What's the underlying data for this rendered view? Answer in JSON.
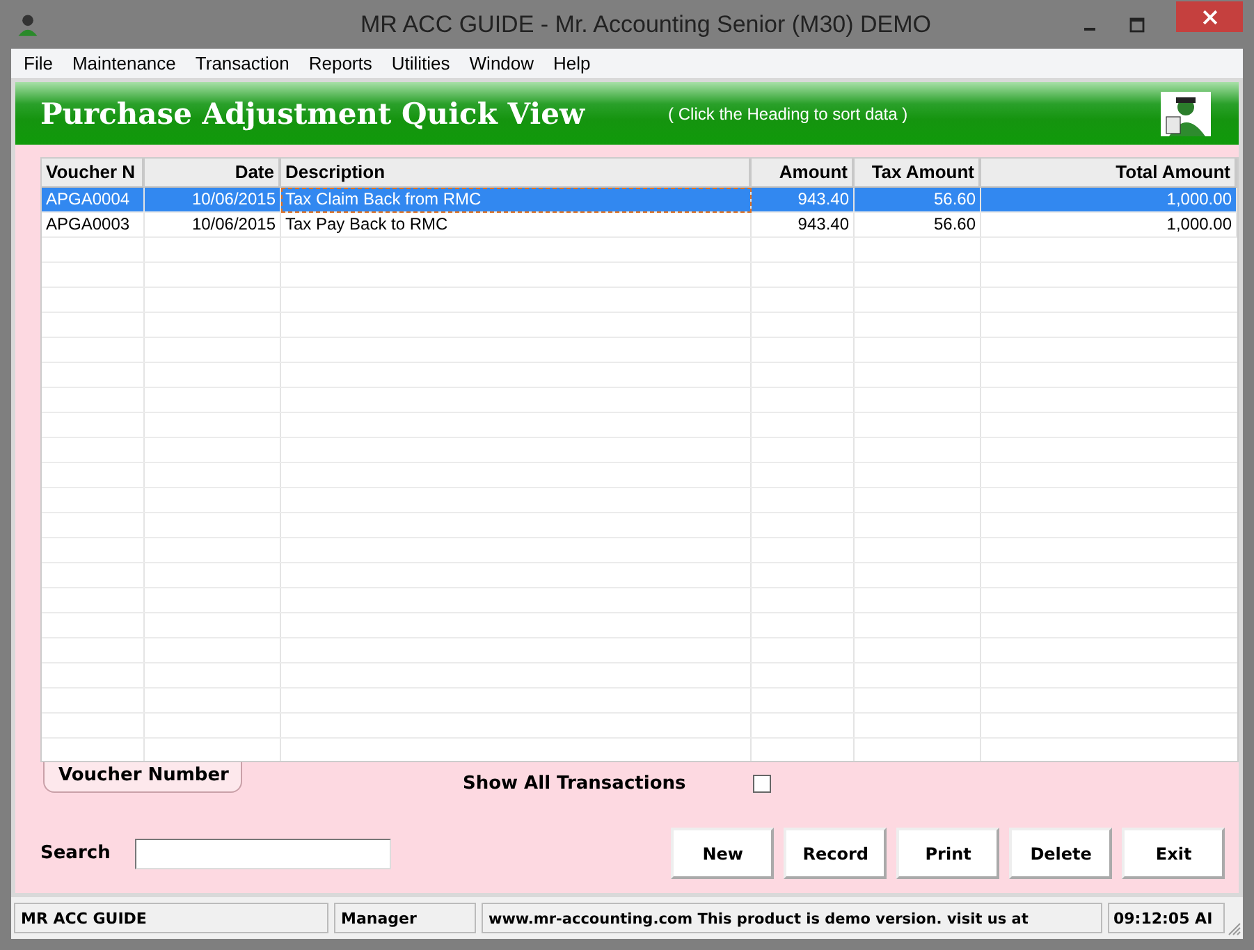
{
  "window": {
    "title": "MR ACC GUIDE - Mr. Accounting Senior (M30) DEMO"
  },
  "menu": [
    "File",
    "Maintenance",
    "Transaction",
    "Reports",
    "Utilities",
    "Window",
    "Help"
  ],
  "header": {
    "title": "Purchase Adjustment Quick View",
    "hint": "( Click the Heading to sort data )"
  },
  "table": {
    "columns": [
      "Voucher N",
      "Date",
      "Description",
      "Amount",
      "Tax Amount",
      "Total Amount"
    ],
    "rows": [
      {
        "selected": true,
        "cells": [
          "APGA0004",
          "10/06/2015",
          "Tax Claim Back from RMC",
          "943.40",
          "56.60",
          "1,000.00"
        ]
      },
      {
        "selected": false,
        "cells": [
          "APGA0003",
          "10/06/2015",
          "Tax Pay Back to RMC",
          "943.40",
          "56.60",
          "1,000.00"
        ]
      }
    ]
  },
  "sort_tab": "Voucher Number",
  "show_all": {
    "label": "Show All Transactions",
    "checked": false
  },
  "search": {
    "label": "Search"
  },
  "buttons": [
    "New",
    "Record",
    "Print",
    "Delete",
    "Exit"
  ],
  "status_bar": [
    "MR ACC GUIDE",
    "Manager",
    "www.mr-accounting.com This product is demo version.  visit us at",
    "09:12:05 AI"
  ]
}
